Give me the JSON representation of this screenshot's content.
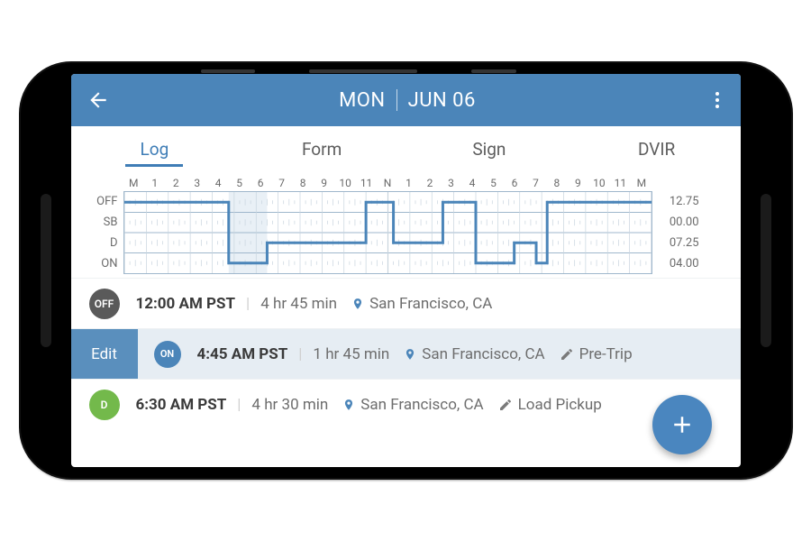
{
  "header": {
    "day": "MON",
    "date": "JUN 06"
  },
  "tabs": [
    {
      "label": "Log",
      "active": true
    },
    {
      "label": "Form",
      "active": false
    },
    {
      "label": "Sign",
      "active": false
    },
    {
      "label": "DVIR",
      "active": false
    }
  ],
  "chart_data": {
    "type": "step",
    "hour_labels": [
      "M",
      "1",
      "2",
      "3",
      "4",
      "5",
      "6",
      "7",
      "8",
      "9",
      "10",
      "11",
      "N",
      "1",
      "2",
      "3",
      "4",
      "5",
      "6",
      "7",
      "8",
      "9",
      "10",
      "11",
      "M"
    ],
    "status_rows": [
      "OFF",
      "SB",
      "D",
      "ON"
    ],
    "totals": {
      "OFF": "12.75",
      "SB": "00.00",
      "D": "07.25",
      "ON": "04.00"
    },
    "shaded_range_hours": [
      4.75,
      6.5
    ],
    "segments": [
      {
        "from_hour": 0.0,
        "to_hour": 4.75,
        "status": "OFF"
      },
      {
        "from_hour": 4.75,
        "to_hour": 6.5,
        "status": "ON"
      },
      {
        "from_hour": 6.5,
        "to_hour": 11.0,
        "status": "D"
      },
      {
        "from_hour": 11.0,
        "to_hour": 12.25,
        "status": "OFF"
      },
      {
        "from_hour": 12.25,
        "to_hour": 14.5,
        "status": "D"
      },
      {
        "from_hour": 14.5,
        "to_hour": 16.0,
        "status": "OFF"
      },
      {
        "from_hour": 16.0,
        "to_hour": 17.75,
        "status": "ON"
      },
      {
        "from_hour": 17.75,
        "to_hour": 18.75,
        "status": "D"
      },
      {
        "from_hour": 18.75,
        "to_hour": 19.25,
        "status": "ON"
      },
      {
        "from_hour": 19.25,
        "to_hour": 24.0,
        "status": "OFF"
      }
    ]
  },
  "edit_label": "Edit",
  "log_entries": [
    {
      "status": "OFF",
      "badge_bg": "#5a5a5a",
      "time": "12:00 AM PST",
      "duration": "4 hr 45 min",
      "location": "San Francisco, CA",
      "note": "",
      "selected": false
    },
    {
      "status": "ON",
      "badge_bg": "#4b85b9",
      "time": "4:45 AM PST",
      "duration": "1 hr 45 min",
      "location": "San Francisco, CA",
      "note": "Pre-Trip",
      "selected": true
    },
    {
      "status": "D",
      "badge_bg": "#73b94b",
      "time": "6:30 AM PST",
      "duration": "4 hr 30 min",
      "location": "San Francisco, CA",
      "note": "Load Pickup",
      "selected": false
    }
  ],
  "colors": {
    "primary": "#4b85b9",
    "fab": "#4a86bf"
  }
}
